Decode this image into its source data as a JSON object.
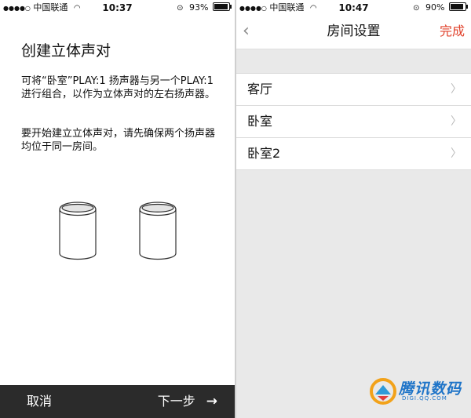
{
  "left_screen": {
    "status": {
      "carrier": "中国联通",
      "time": "10:37",
      "battery": "93%",
      "battery_level": 0.93
    },
    "title": "创建立体声对",
    "description": "可将“卧室”PLAY:1 扬声器与另一个PLAY:1 进行组合，以作为立体声对的左右扬声器。",
    "instruction": "要开始建立立体声对，请先确保两个扬声器均位于同一房间。",
    "footer": {
      "cancel_label": "取消",
      "next_label": "下一步"
    }
  },
  "right_screen": {
    "status": {
      "carrier": "中国联通",
      "time": "10:47",
      "battery": "90%",
      "battery_level": 0.9
    },
    "nav": {
      "title": "房间设置",
      "done_label": "完成"
    },
    "rooms": [
      {
        "label": "客厅"
      },
      {
        "label": "卧室"
      },
      {
        "label": "卧室2"
      }
    ]
  },
  "watermark": {
    "text": "腾讯数码",
    "sub": "DIGI.QQ.COM"
  },
  "colors": {
    "accent": "#e0402a",
    "footer_bg": "#2b2b2b",
    "list_bg": "#e9e9e9"
  }
}
